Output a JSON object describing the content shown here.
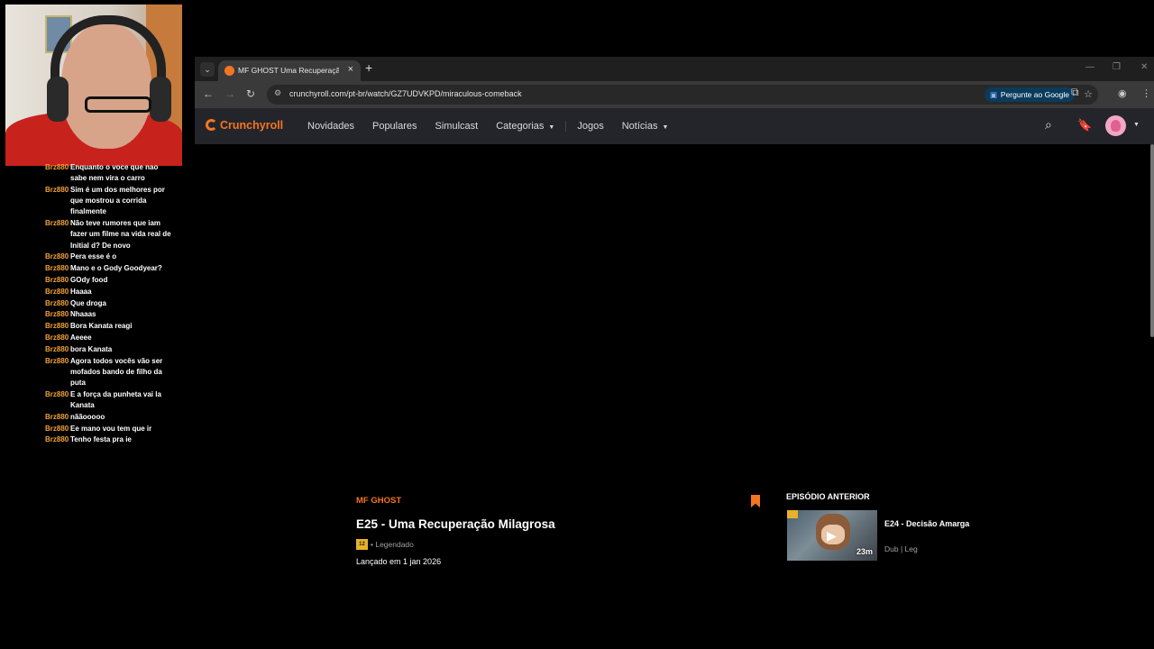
{
  "chat": {
    "messages": [
      {
        "user": "Brz880",
        "text": "Enquanto o voce que nao sabe nem vira o carro"
      },
      {
        "user": "Brz880",
        "text": "Sim é um dos melhores por que mostrou a corrida finalmente"
      },
      {
        "user": "Brz880",
        "text": "Não teve rumores que iam fazer um filme na vida real de Initial d? De novo"
      },
      {
        "user": "Brz880",
        "text": "Pera esse é o"
      },
      {
        "user": "Brz880",
        "text": "Mano e o Gody Goodyear?"
      },
      {
        "user": "Brz880",
        "text": "GOdy food"
      },
      {
        "user": "Brz880",
        "text": "Haaaa"
      },
      {
        "user": "Brz880",
        "text": "Que droga"
      },
      {
        "user": "Brz880",
        "text": "Nhaaas"
      },
      {
        "user": "Brz880",
        "text": "Bora Kanata reagi"
      },
      {
        "user": "Brz880",
        "text": "Aeeee"
      },
      {
        "user": "Brz880",
        "text": "bora Kanata"
      },
      {
        "user": "Brz880",
        "text": "Agora todos vocês vão ser mofados bando de filho da puta"
      },
      {
        "user": "Brz880",
        "text": "E a força da punheta vai la Kanata"
      },
      {
        "user": "Brz880",
        "text": "nããooooo"
      },
      {
        "user": "Brz880",
        "text": "Ee mano vou tem que ir"
      },
      {
        "user": "Brz880",
        "text": "Tenho festa pra ie"
      }
    ]
  },
  "browser": {
    "tab_title": "MF GHOST Uma Recuperação Milagrosa",
    "tab_close": "×",
    "new_tab": "+",
    "tab_search_icon": "⌄",
    "url": "crunchyroll.com/pt-br/watch/GZ7UDVKPD/miraculous-comeback",
    "ask_google": "Pergunte ao Google",
    "window_controls": {
      "minimize": "—",
      "restore": "❐",
      "close": "✕"
    },
    "nav": {
      "back": "←",
      "forward": "→",
      "reload": "↻"
    }
  },
  "site": {
    "logo": "Crunchyroll",
    "brand_color": "#f47521",
    "nav": [
      "Novidades",
      "Populares",
      "Simulcast",
      "Categorias",
      "Jogos",
      "Notícias"
    ]
  },
  "episode": {
    "show": "MF GHOST",
    "title": "E25 - Uma Recuperação Milagrosa",
    "rating_badge": "12",
    "sub_label": "• Legendado",
    "release": "Lançado em 1 jan 2026"
  },
  "previous": {
    "heading": "EPISÓDIO ANTERIOR",
    "title": "E24 - Decisão Amarga",
    "duration": "23m",
    "meta": "Dub | Leg"
  }
}
